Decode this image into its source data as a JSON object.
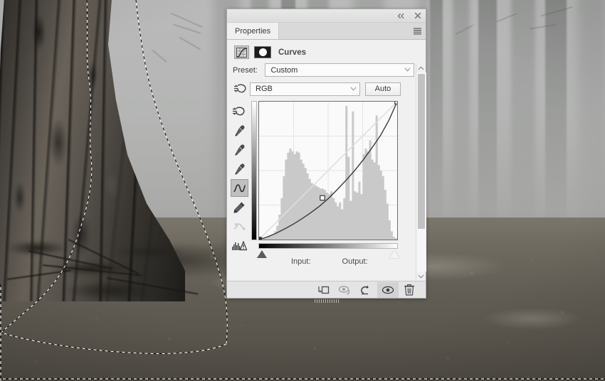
{
  "panel": {
    "titlebar": {
      "collapse_icon": "double-chevron-left-icon",
      "close_icon": "close-icon"
    },
    "tab_label": "Properties",
    "menu_icon": "hamburger-menu-icon",
    "adjustment": {
      "icon": "curves-adjustment-icon",
      "mask_thumbnail": "layer-mask-thumbnail",
      "title": "Curves"
    },
    "preset": {
      "label": "Preset:",
      "value": "Custom",
      "chevron_icon": "chevron-down-icon"
    },
    "channel": {
      "on_image_icon": "on-image-adjustment-icon",
      "value": "RGB",
      "chevron_icon": "chevron-down-icon",
      "auto_label": "Auto"
    },
    "tools": [
      {
        "name": "on-image-adjust-tool",
        "icon": "hand-scrub-icon",
        "active": false,
        "disabled": false
      },
      {
        "name": "black-point-eyedropper",
        "icon": "eyedropper-icon",
        "active": false,
        "disabled": false
      },
      {
        "name": "gray-point-eyedropper",
        "icon": "eyedropper-icon",
        "active": false,
        "disabled": false
      },
      {
        "name": "white-point-eyedropper",
        "icon": "eyedropper-icon",
        "active": false,
        "disabled": false
      },
      {
        "name": "edit-points-curve-tool",
        "icon": "curve-icon",
        "active": true,
        "disabled": false
      },
      {
        "name": "draw-curve-pencil-tool",
        "icon": "pencil-icon",
        "active": false,
        "disabled": false
      },
      {
        "name": "smooth-curve-tool",
        "icon": "smooth-curve-icon",
        "active": false,
        "disabled": true
      },
      {
        "name": "histogram-clipping-warning",
        "icon": "histogram-warning-icon",
        "active": false,
        "disabled": false
      }
    ],
    "graph": {
      "input_label": "Input:",
      "output_label": "Output:",
      "input_value": "",
      "output_value": "",
      "black_point_slider": "black-point-triangle",
      "white_point_slider": "white-point-triangle",
      "vertical_gradient": "output-gradient-strip",
      "horizontal_gradient": "input-gradient-strip"
    },
    "scrollbar": {
      "up_icon": "chevron-up-icon",
      "down_icon": "chevron-down-icon"
    },
    "footer_buttons": [
      {
        "name": "clip-to-layer-button",
        "icon": "clip-to-layer-icon",
        "active": false,
        "dim": false
      },
      {
        "name": "toggle-mask-view-button",
        "icon": "eye-arrow-icon",
        "active": false,
        "dim": true
      },
      {
        "name": "reset-adjustment-button",
        "icon": "reset-arrow-icon",
        "active": false,
        "dim": false
      },
      {
        "name": "toggle-layer-visibility-button",
        "icon": "eye-icon",
        "active": true,
        "dim": false
      },
      {
        "name": "delete-adjustment-layer-button",
        "icon": "trash-icon",
        "active": false,
        "dim": false
      }
    ]
  },
  "colors": {
    "panel_bg": "#f0f0f0",
    "panel_border": "#a9a9a9",
    "tab_bg": "#d9d9d9",
    "graph_bg": "#fafafa",
    "grid_line": "#e2e2e2",
    "curve_line": "#3a3a3a",
    "baseline": "#dcdcdc",
    "histogram": "#c6c6c6",
    "footer_bg": "#e4e4e4",
    "selection_ant": "#ffffff"
  },
  "chart_data": {
    "type": "line",
    "title": "Curves",
    "xlabel": "Input",
    "ylabel": "Output",
    "xlim": [
      0,
      255
    ],
    "ylim": [
      0,
      255
    ],
    "grid": true,
    "grid_divisions": 4,
    "series": [
      {
        "name": "baseline-diagonal",
        "x": [
          0,
          255
        ],
        "y": [
          0,
          255
        ]
      },
      {
        "name": "rgb-curve",
        "control_points": [
          {
            "input": 0,
            "output": 0
          },
          {
            "input": 117,
            "output": 77
          },
          {
            "input": 255,
            "output": 255
          }
        ],
        "x": [
          0,
          16,
          32,
          48,
          64,
          80,
          96,
          112,
          128,
          144,
          160,
          176,
          192,
          208,
          224,
          240,
          255
        ],
        "y": [
          0,
          5,
          12,
          20,
          29,
          39,
          50,
          62,
          76,
          92,
          109,
          127,
          147,
          169,
          192,
          221,
          255
        ]
      }
    ],
    "histogram": {
      "name": "rgb-histogram",
      "bins": 64,
      "values": [
        2,
        1,
        1,
        1,
        2,
        3,
        4,
        6,
        10,
        18,
        30,
        46,
        58,
        63,
        66,
        64,
        62,
        64,
        63,
        58,
        55,
        52,
        48,
        44,
        41,
        40,
        39,
        38,
        37,
        37,
        36,
        34,
        33,
        35,
        30,
        27,
        24,
        27,
        22,
        30,
        97,
        60,
        28,
        93,
        35,
        34,
        42,
        33,
        62,
        66,
        64,
        72,
        58,
        56,
        90,
        54,
        50,
        46,
        36,
        26,
        14,
        6,
        2,
        1
      ],
      "max": 100
    }
  }
}
